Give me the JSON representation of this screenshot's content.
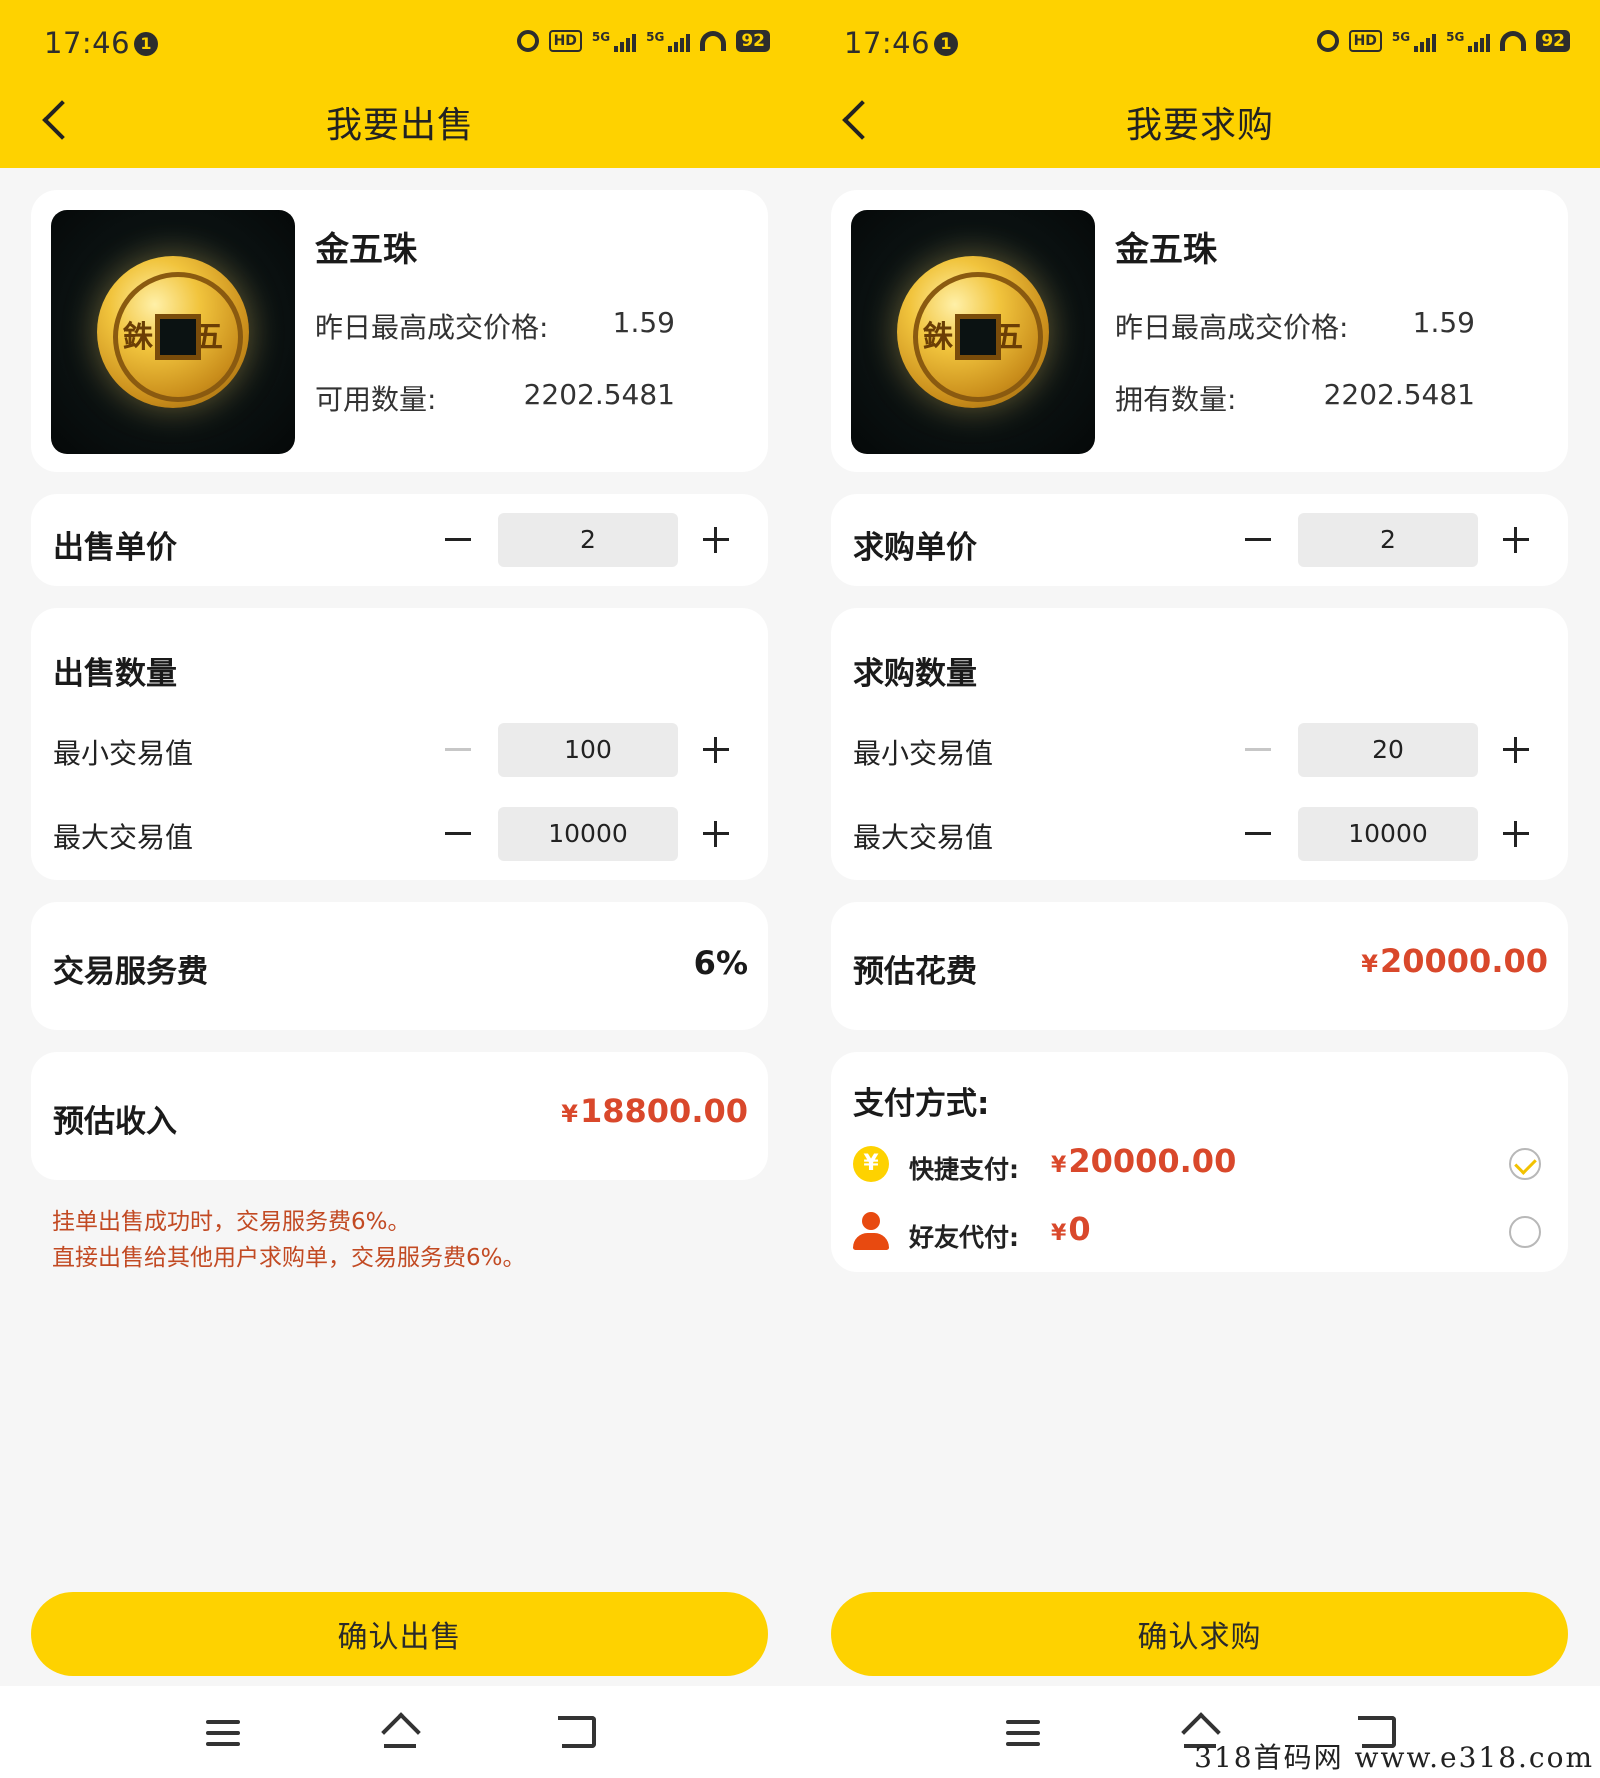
{
  "status_bar": {
    "time": "17:46",
    "notif_badge": "1",
    "hd": "HD",
    "sig1": "5G",
    "sig2": "5G",
    "battery": "92"
  },
  "colors": {
    "accent": "#fed200",
    "money": "#d9482b",
    "note": "#c24a23",
    "friend_icon": "#e84a10"
  },
  "product": {
    "name": "金五珠",
    "coin_chars": [
      "銖",
      "五"
    ],
    "yesterday_label": "昨日最高成交价格:",
    "yesterday_value": "1.59",
    "qty_value": "2202.5481"
  },
  "sell": {
    "title": "我要出售",
    "qty_label": "可用数量:",
    "price_title": "出售单价",
    "price_value": "2",
    "quantity_title": "出售数量",
    "min_label": "最小交易值",
    "min_value": "100",
    "max_label": "最大交易值",
    "max_value": "10000",
    "fee_label": "交易服务费",
    "fee_value": "6%",
    "income_label": "预估收入",
    "income_currency": "¥",
    "income_value": "18800.00",
    "note_1": "挂单出售成功时，交易服务费6%。",
    "note_2": "直接出售给其他用户求购单，交易服务费6%。",
    "confirm_label": "确认出售"
  },
  "buy": {
    "title": "我要求购",
    "qty_label": "拥有数量:",
    "price_title": "求购单价",
    "price_value": "2",
    "quantity_title": "求购数量",
    "min_label": "最小交易值",
    "min_value": "20",
    "max_label": "最大交易值",
    "max_value": "10000",
    "cost_label": "预估花费",
    "cost_currency": "¥",
    "cost_value": "20000.00",
    "payment_title": "支付方式:",
    "payment_methods": [
      {
        "icon": "yuan-coin-icon",
        "icon_glyph": "¥",
        "label": "快捷支付:",
        "currency": "¥",
        "amount": "20000.00",
        "selected": true
      },
      {
        "icon": "user-icon",
        "label": "好友代付:",
        "currency": "¥",
        "amount": "0",
        "selected": false
      }
    ],
    "confirm_label": "确认求购"
  },
  "watermark": "318首码网  www.e318.com"
}
